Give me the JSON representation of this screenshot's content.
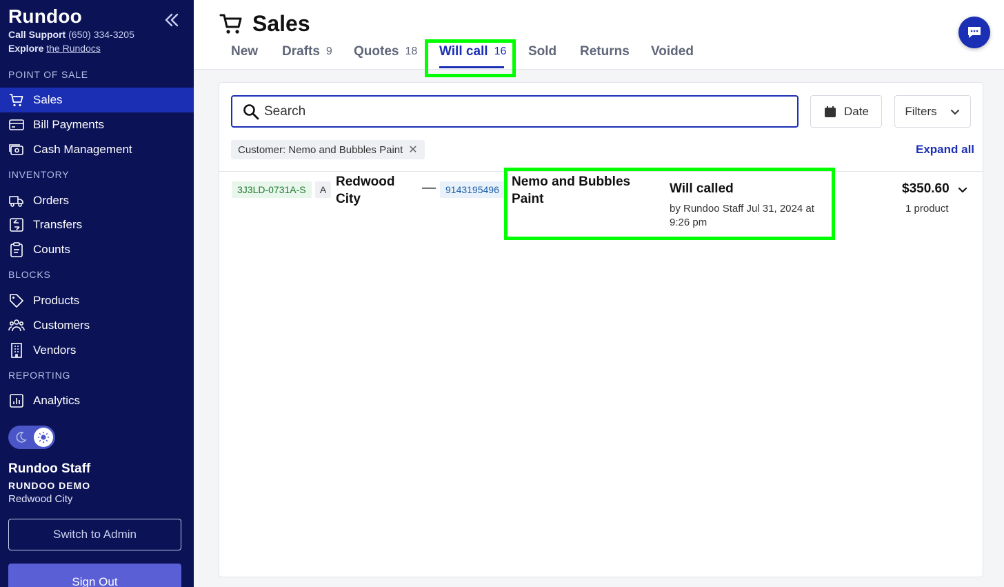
{
  "sidebar": {
    "brand": "Rundoo",
    "support_label": "Call Support",
    "support_phone": "(650) 334-3205",
    "explore_label": "Explore",
    "explore_link": "the Rundocs",
    "sections": {
      "pos": "POINT OF SALE",
      "inventory": "INVENTORY",
      "blocks": "BLOCKS",
      "reporting": "REPORTING"
    },
    "items": {
      "sales": "Sales",
      "bill_payments": "Bill Payments",
      "cash_management": "Cash Management",
      "orders": "Orders",
      "transfers": "Transfers",
      "counts": "Counts",
      "products": "Products",
      "customers": "Customers",
      "vendors": "Vendors",
      "analytics": "Analytics"
    },
    "user": {
      "name": "Rundoo Staff",
      "org": "RUNDOO DEMO",
      "city": "Redwood City"
    },
    "switch_label": "Switch to Admin",
    "signout_label": "Sign Out"
  },
  "header": {
    "title": "Sales",
    "tabs": [
      {
        "label": "New",
        "count": ""
      },
      {
        "label": "Drafts",
        "count": "9"
      },
      {
        "label": "Quotes",
        "count": "18"
      },
      {
        "label": "Will call",
        "count": "16"
      },
      {
        "label": "Sold",
        "count": ""
      },
      {
        "label": "Returns",
        "count": ""
      },
      {
        "label": "Voided",
        "count": ""
      }
    ],
    "active_tab": "Will call"
  },
  "toolbar": {
    "search_placeholder": "Search",
    "date_label": "Date",
    "filters_label": "Filters",
    "chip_label": "Customer: Nemo and Bubbles Paint",
    "expand_all": "Expand all"
  },
  "rows": [
    {
      "order_id": "3J3LD-0731A-S",
      "badge": "A",
      "location": "Redwood City",
      "dash": "—",
      "phone": "9143195496",
      "customer": "Nemo and Bubbles Paint",
      "status": "Will called",
      "status_detail": "by Rundoo Staff Jul 31, 2024 at 9:26 pm",
      "amount": "$350.60",
      "products": "1 product"
    }
  ],
  "colors": {
    "sidebar_bg": "#0b1256",
    "accent": "#1b2fb5",
    "highlight": "#00ff00"
  }
}
